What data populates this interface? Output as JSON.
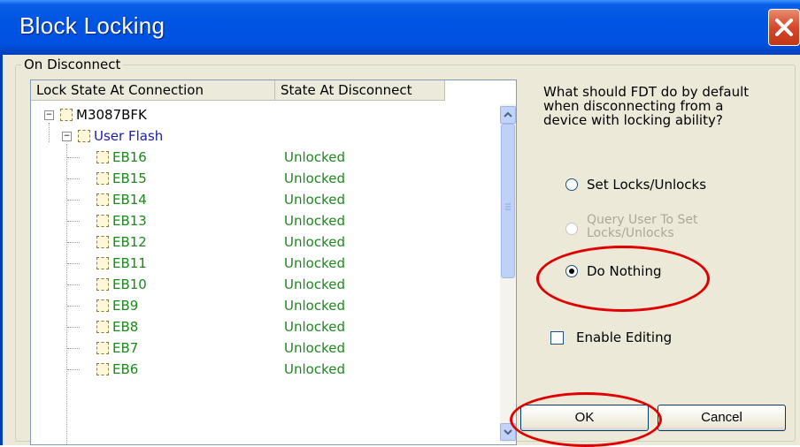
{
  "window": {
    "title": "Block Locking"
  },
  "group": {
    "label": "On Disconnect"
  },
  "tree": {
    "headers": [
      "Lock State At Connection",
      "State At Disconnect"
    ],
    "root": {
      "label": "M3087BFK"
    },
    "child": {
      "label": "User Flash"
    },
    "blocks": [
      {
        "name": "EB16",
        "state": "Unlocked"
      },
      {
        "name": "EB15",
        "state": "Unlocked"
      },
      {
        "name": "EB14",
        "state": "Unlocked"
      },
      {
        "name": "EB13",
        "state": "Unlocked"
      },
      {
        "name": "EB12",
        "state": "Unlocked"
      },
      {
        "name": "EB11",
        "state": "Unlocked"
      },
      {
        "name": "EB10",
        "state": "Unlocked"
      },
      {
        "name": "EB9",
        "state": "Unlocked"
      },
      {
        "name": "EB8",
        "state": "Unlocked"
      },
      {
        "name": "EB7",
        "state": "Unlocked"
      },
      {
        "name": "EB6",
        "state": "Unlocked"
      }
    ]
  },
  "prompt": {
    "line1": "What should FDT do by default",
    "line2": "when disconnecting from a",
    "line3": "device with locking ability?"
  },
  "options": {
    "set_locks": "Set Locks/Unlocks",
    "query_user_line1": "Query User To Set",
    "query_user_line2": "Locks/Unlocks",
    "do_nothing": "Do Nothing",
    "selected": "Do Nothing"
  },
  "enable_editing": {
    "label": "Enable Editing",
    "checked": false
  },
  "buttons": {
    "ok": "OK",
    "cancel": "Cancel"
  },
  "colors": {
    "titlebar": "#0054e3",
    "state_text": "#1b8a1b",
    "child_text": "#1c1caa",
    "annotation": "#e00000"
  }
}
